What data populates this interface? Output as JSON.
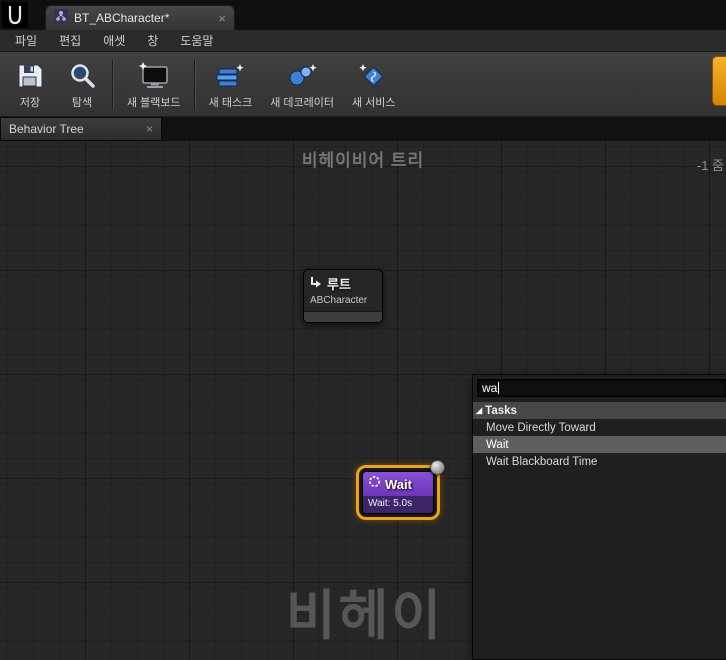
{
  "window": {
    "asset_tab": {
      "title": "BT_ABCharacter*",
      "close_glyph": "×"
    }
  },
  "menu_bar": {
    "items": [
      "파일",
      "편집",
      "애셋",
      "창",
      "도움말"
    ]
  },
  "toolbar": {
    "buttons": [
      {
        "label": "저장",
        "icon": "save-icon"
      },
      {
        "label": "탐색",
        "icon": "browse-icon"
      },
      {
        "label": "새 블랙보드",
        "icon": "new-blackboard-icon"
      },
      {
        "label": "새 태스크",
        "icon": "new-task-icon"
      },
      {
        "label": "새 데코레이터",
        "icon": "new-decorator-icon"
      },
      {
        "label": "새 서비스",
        "icon": "new-service-icon"
      }
    ]
  },
  "doc_tabs": {
    "active": {
      "label": "Behavior Tree",
      "close_glyph": "×"
    }
  },
  "graph": {
    "title": "비헤이비어 트리",
    "zoom_label": "-1 줌",
    "watermark": "비헤이"
  },
  "nodes": {
    "root": {
      "title": "루트",
      "subtitle": "ABCharacter"
    },
    "wait": {
      "title": "Wait",
      "detail": "Wait: 5.0s"
    }
  },
  "context_menu": {
    "search_value": "wa",
    "category": "Tasks",
    "expand_glyph": "◢",
    "items": [
      "Move Directly Toward",
      "Wait",
      "Wait Blackboard Time"
    ],
    "selected": "Wait"
  },
  "colors": {
    "selection_orange": "#f2a30a",
    "task_purple": "#7a3fd0",
    "toolbar_accent_orange": "#e9920b"
  }
}
